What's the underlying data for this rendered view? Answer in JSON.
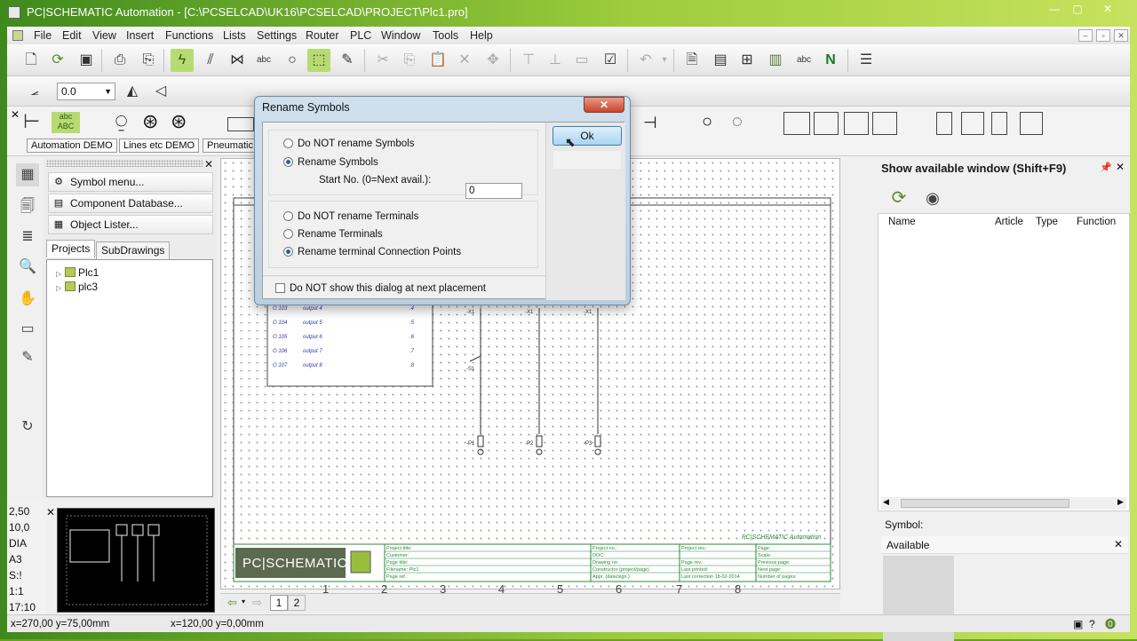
{
  "window": {
    "title": "PC|SCHEMATIC Automation - [C:\\PCSELCAD\\UK16\\PCSELCAD\\PROJECT\\Plc1.pro]",
    "controls": [
      "—",
      "▢",
      "✕"
    ]
  },
  "menu": [
    "File",
    "Edit",
    "View",
    "Insert",
    "Functions",
    "Lists",
    "Settings",
    "Router",
    "PLC",
    "Window",
    "Tools",
    "Help"
  ],
  "toolbar": {
    "zoom_value": "0.0"
  },
  "symbol_tabs": [
    "Automation DEMO",
    "Lines etc DEMO",
    "Pneumatic"
  ],
  "left_panel": {
    "buttons": [
      "Symbol menu...",
      "Component Database...",
      "Object Lister..."
    ],
    "tabs": [
      "Projects",
      "SubDrawings"
    ],
    "tree": [
      "Plc1",
      "plc3"
    ]
  },
  "scale_list": [
    "2,50",
    "10,0",
    "DIA",
    "A3",
    "S:!",
    "1:1",
    "17:10"
  ],
  "drawing": {
    "page_tabs": [
      "1",
      "2"
    ],
    "column_numbers": [
      "1",
      "2",
      "3",
      "4",
      "5",
      "6",
      "7",
      "8"
    ],
    "logo_text": "PC|SCHEMATIC",
    "footer_brand": "PC|SCHEMATIC Automation"
  },
  "right_panel": {
    "title": "Show available window (Shift+F9)",
    "columns": [
      "Name",
      "Article",
      "Type",
      "Function"
    ],
    "symbol_label": "Symbol:",
    "available_label": "Available"
  },
  "status": {
    "left": "x=270,00 y=75,00mm",
    "right": "x=120,00 y=0,00mm"
  },
  "dialog": {
    "title": "Rename Symbols",
    "close": "✕",
    "ok": "Ok",
    "symbol_options": [
      {
        "label": "Do NOT rename Symbols",
        "checked": false
      },
      {
        "label": "Rename Symbols",
        "checked": true
      }
    ],
    "start_no_label": "Start No. (0=Next avail.):",
    "start_no_value": "0",
    "terminal_options": [
      {
        "label": "Do NOT rename Terminals",
        "checked": false
      },
      {
        "label": "Rename Terminals",
        "checked": false
      },
      {
        "label": "Rename terminal Connection Points",
        "checked": true
      }
    ],
    "dont_show_label": "Do NOT show this dialog at next placement"
  },
  "colors": {
    "accent_green": "#6aa020",
    "dialog_frame": "#b8cfe2",
    "ok_blue": "#a9d4f2"
  }
}
